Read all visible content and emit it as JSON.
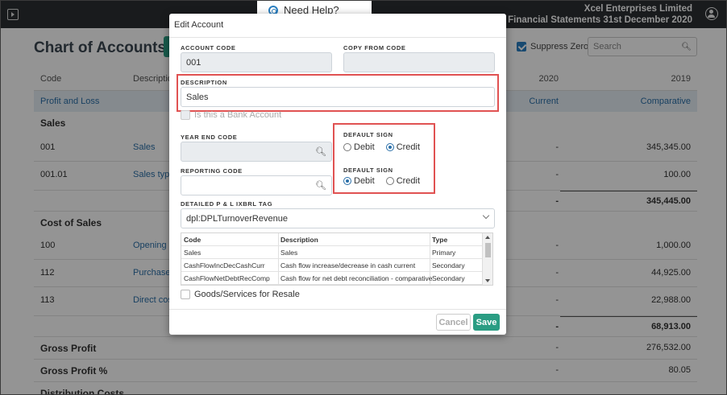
{
  "header": {
    "company": "Xcel Enterprises Limited",
    "report": "Financial Statements 31st December 2020"
  },
  "help": {
    "label": "Need Help?"
  },
  "page": {
    "title": "Chart of Accounts",
    "suppress_label": "Suppress Zero",
    "search_placeholder": "Search",
    "columns": {
      "code": "Code",
      "description": "Descriptio",
      "year1": "2020",
      "year2": "2019"
    },
    "subheader": {
      "left": "Profit and Loss",
      "current": "Current",
      "comparative": "Comparative"
    },
    "sections": {
      "sales": "Sales",
      "cost_of_sales": "Cost of Sales",
      "gross_profit": "Gross Profit",
      "gross_profit_pct": "Gross Profit %",
      "distribution": "Distribution Costs"
    },
    "rows": [
      {
        "code": "001",
        "desc": "Sales",
        "current": "-",
        "comparative": "345,345.00"
      },
      {
        "code": "001.01",
        "desc": "Sales type I",
        "current": "-",
        "comparative": "100.00"
      },
      {
        "code": "100",
        "desc": "Opening st",
        "current": "-",
        "comparative": "1,000.00"
      },
      {
        "code": "112",
        "desc": "Purchases",
        "current": "-",
        "comparative": "44,925.00"
      },
      {
        "code": "113",
        "desc": "Direct cost",
        "current": "-",
        "comparative": "22,988.00"
      }
    ],
    "totals": {
      "sales": {
        "current": "-",
        "comparative": "345,445.00"
      },
      "cos": {
        "current": "-",
        "comparative": "68,913.00"
      },
      "gross_profit": {
        "current": "-",
        "comparative": "276,532.00"
      },
      "gross_profit_pct": {
        "current": "-",
        "comparative": "80.05"
      }
    }
  },
  "modal": {
    "title": "Edit Account",
    "account_code_label": "ACCOUNT CODE",
    "account_code_value": "001",
    "copy_from_label": "COPY FROM CODE",
    "copy_from_value": "",
    "description_label": "DESCRIPTION",
    "description_value": "Sales",
    "bank_account_label": "Is this a Bank Account",
    "year_end_label": "YEAR END CODE",
    "reporting_label": "REPORTING CODE",
    "default_sign_label": "DEFAULT SIGN",
    "sign1": {
      "debit": "Debit",
      "credit": "Credit",
      "selected": "credit"
    },
    "sign2": {
      "debit": "Debit",
      "credit": "Credit",
      "selected": "debit"
    },
    "ixbrl_label": "DETAILED P & L IXBRL TAG",
    "ixbrl_value": "dpl:DPLTurnoverRevenue",
    "tag_table": {
      "headers": [
        "Code",
        "Description",
        "Type"
      ],
      "rows": [
        [
          "Sales",
          "Sales",
          "Primary"
        ],
        [
          "CashFlowIncDecCashCurr",
          "Cash flow increase/decrease in cash current",
          "Secondary"
        ],
        [
          "CashFlowNetDebtRecComp",
          "Cash flow for net debt reconciliation - comparative",
          "Secondary"
        ]
      ]
    },
    "goods_label": "Goods/Services for Resale",
    "cancel_label": "Cancel",
    "save_label": "Save"
  }
}
